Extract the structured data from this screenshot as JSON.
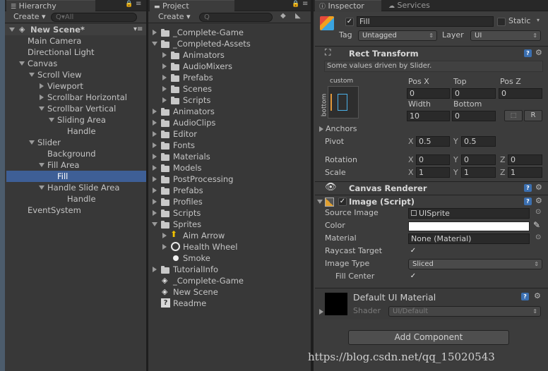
{
  "hierarchy": {
    "tab_label": "Hierarchy",
    "create_label": "Create",
    "search_placeholder": "Q▾All",
    "scene_name": "New Scene*",
    "items": [
      {
        "label": "Main Camera"
      },
      {
        "label": "Directional Light"
      },
      {
        "label": "Canvas"
      },
      {
        "label": "Scroll View"
      },
      {
        "label": "Viewport"
      },
      {
        "label": "Scrollbar Horizontal"
      },
      {
        "label": "Scrollbar Vertical"
      },
      {
        "label": "Sliding Area"
      },
      {
        "label": "Handle"
      },
      {
        "label": "Slider"
      },
      {
        "label": "Background"
      },
      {
        "label": "Fill Area"
      },
      {
        "label": "Fill"
      },
      {
        "label": "Handle Slide Area"
      },
      {
        "label": "Handle"
      },
      {
        "label": "EventSystem"
      }
    ]
  },
  "project": {
    "tab_label": "Project",
    "create_label": "Create",
    "items": [
      {
        "label": "_Complete-Game"
      },
      {
        "label": "_Completed-Assets"
      },
      {
        "label": "Animators"
      },
      {
        "label": "AudioMixers"
      },
      {
        "label": "Prefabs"
      },
      {
        "label": "Scenes"
      },
      {
        "label": "Scripts"
      },
      {
        "label": "Animators"
      },
      {
        "label": "AudioClips"
      },
      {
        "label": "Editor"
      },
      {
        "label": "Fonts"
      },
      {
        "label": "Materials"
      },
      {
        "label": "Models"
      },
      {
        "label": "PostProcessing"
      },
      {
        "label": "Prefabs"
      },
      {
        "label": "Profiles"
      },
      {
        "label": "Scripts"
      },
      {
        "label": "Sprites"
      },
      {
        "label": "Aim Arrow"
      },
      {
        "label": "Health Wheel"
      },
      {
        "label": "Smoke"
      },
      {
        "label": "TutorialInfo"
      },
      {
        "label": "_Complete-Game"
      },
      {
        "label": "New Scene"
      },
      {
        "label": "Readme"
      }
    ]
  },
  "inspector": {
    "tab_label": "Inspector",
    "services_tab_label": "Services",
    "object_name": "Fill",
    "static_label": "Static",
    "tag_label": "Tag",
    "tag_value": "Untagged",
    "layer_label": "Layer",
    "layer_value": "UI",
    "rect_transform": {
      "title": "Rect Transform",
      "note": "Some values driven by Slider.",
      "anchor_preset_top": "custom",
      "anchor_preset_side": "bottom",
      "pos_x_label": "Pos X",
      "pos_x": "0",
      "top_label": "Top",
      "top": "0",
      "pos_z_label": "Pos Z",
      "pos_z": "0",
      "width_label": "Width",
      "width": "10",
      "bottom_label": "Bottom",
      "bottom": "0",
      "r_label": "R",
      "anchors_label": "Anchors",
      "pivot_label": "Pivot",
      "pivot_x": "0.5",
      "pivot_y": "0.5",
      "rotation_label": "Rotation",
      "rot_x": "0",
      "rot_y": "0",
      "rot_z": "0",
      "scale_label": "Scale",
      "scale_x": "1",
      "scale_y": "1",
      "scale_z": "1",
      "x": "X",
      "y": "Y",
      "z": "Z"
    },
    "canvas_renderer": {
      "title": "Canvas Renderer"
    },
    "image": {
      "title": "Image (Script)",
      "source_image_label": "Source Image",
      "source_image": "UISprite",
      "color_label": "Color",
      "material_label": "Material",
      "material": "None (Material)",
      "raycast_label": "Raycast Target",
      "image_type_label": "Image Type",
      "image_type": "Sliced",
      "fill_center_label": "Fill Center"
    },
    "material_preview": {
      "name": "Default UI Material",
      "shader_label": "Shader",
      "shader": "UI/Default"
    },
    "add_component_label": "Add Component"
  },
  "watermark": "https://blog.csdn.net/qq_15020543",
  "colors": {
    "selection": "#3e5f96",
    "background": "#383838",
    "tabbar": "#282828"
  }
}
